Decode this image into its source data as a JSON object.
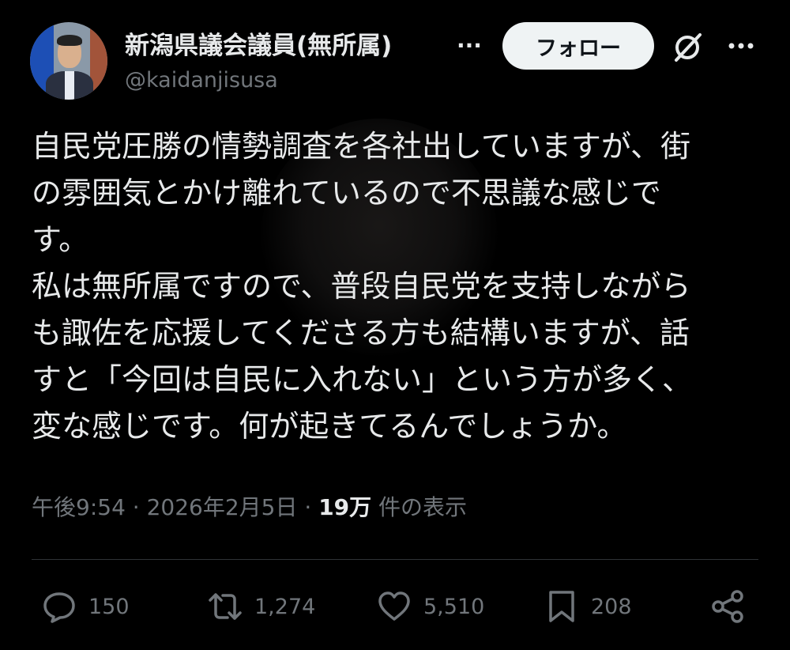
{
  "author": {
    "display_name": "新潟県議会議員(無所属)",
    "name_overflow": "...",
    "handle": "@kaidanjisusa",
    "follow_label": "フォロー"
  },
  "header_icons": {
    "grok": "grok-slash-icon",
    "more": "more-horizontal-icon"
  },
  "tweet": {
    "text": "自民党圧勝の情勢調査を各社出していますが、街\nの雰囲気とかけ離れているので不思議な感じで\nす。\n私は無所属ですので、普段自民党を支持しながら\nも諏佐を応援してくださる方も結構いますが、話\nすと「今回は自民に入れない」という方が多く、\n変な感じです。何が起きてるんでしょうか。"
  },
  "meta": {
    "time": "午後9:54",
    "sep1": " · ",
    "date": "2026年2月5日",
    "sep2": " · ",
    "views_number": "19万",
    "views_label": " 件の表示"
  },
  "actions": {
    "reply_count": "150",
    "retweet_count": "1,274",
    "like_count": "5,510",
    "bookmark_count": "208"
  },
  "colors": {
    "background": "#000000",
    "text_primary": "#e7e9ea",
    "text_secondary": "#71767b",
    "follow_button_bg": "#eff3f4",
    "divider": "#2f3336"
  }
}
